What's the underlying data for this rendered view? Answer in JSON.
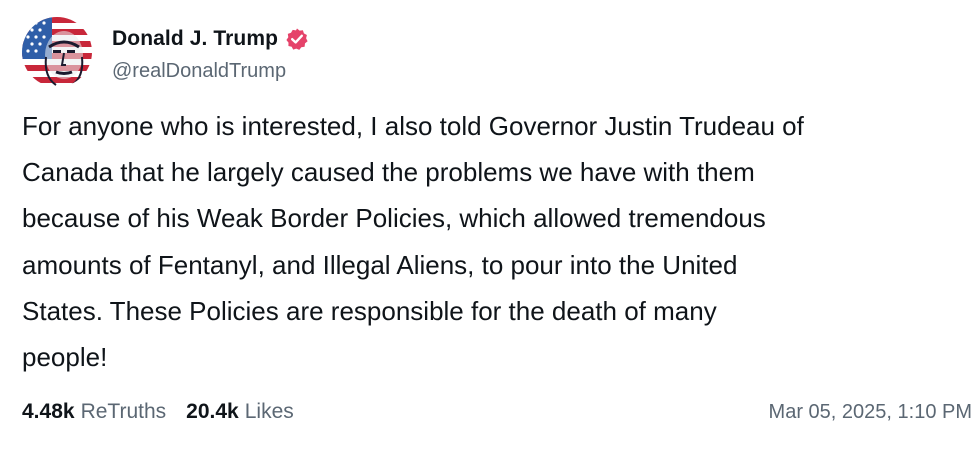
{
  "author": {
    "display_name": "Donald J. Trump",
    "handle": "@realDonaldTrump",
    "verified": true,
    "verified_badge_color": "#e5436a",
    "avatar_icon": "flag-portrait-avatar"
  },
  "post": {
    "lines": [
      "For anyone who is interested, I also told Governor Justin Trudeau of",
      "Canada that he largely caused the problems we have with them",
      "because of his Weak Border Policies, which allowed tremendous",
      "amounts of Fentanyl, and Illegal Aliens, to pour into the United",
      "States. These Policies are responsible for the death of many",
      "people!"
    ]
  },
  "stats": {
    "retruths_count": "4.48k",
    "retruths_label": "ReTruths",
    "likes_count": "20.4k",
    "likes_label": "Likes"
  },
  "timestamp": "Mar 05, 2025, 1:10 PM",
  "colors": {
    "text_primary": "#0f1419",
    "text_secondary": "#5b6773",
    "background": "#ffffff"
  }
}
